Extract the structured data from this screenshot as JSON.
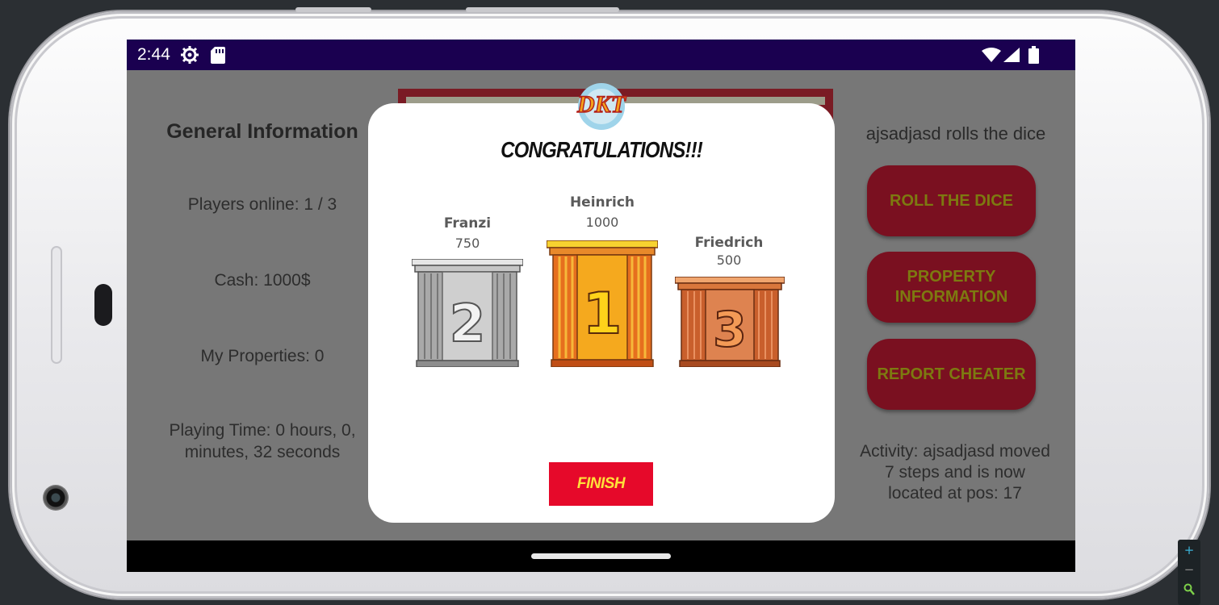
{
  "status_bar": {
    "time": "2:44"
  },
  "left_panel": {
    "title": "General Information",
    "players_online": "Players online: 1 / 3",
    "cash": "Cash: 1000$",
    "properties": "My Properties: 0",
    "playing_time_line1": "Playing Time: 0 hours, 0,",
    "playing_time_line2": "minutes, 32 seconds"
  },
  "right_panel": {
    "turn_text": "ajsadjasd rolls the dice",
    "roll_button": "ROLL THE DICE",
    "property_button_line1": "PROPERTY",
    "property_button_line2": "INFORMATION",
    "report_button": "REPORT CHEATER",
    "activity_line1": "Activity: ajsadjasd moved",
    "activity_line2": "7 steps and is now",
    "activity_line3": "located at pos: 17"
  },
  "dialog": {
    "logo_text": "DKT",
    "title": "CONGRATULATIONS!!!",
    "podium": [
      {
        "rank": "2",
        "name": "Franzi",
        "score": "750"
      },
      {
        "rank": "1",
        "name": "Heinrich",
        "score": "1000"
      },
      {
        "rank": "3",
        "name": "Friedrich",
        "score": "500"
      }
    ],
    "finish_button": "FINISH"
  },
  "colors": {
    "status_bar": "#1a0050",
    "overlay_bg": "#777777",
    "action_button": "#7a1020",
    "action_button_text": "#7d7a10",
    "finish_button": "#e6092a",
    "finish_text": "#ffe13a",
    "gold": "#f2a51c",
    "silver": "#b8b8b8",
    "bronze": "#d2703a"
  }
}
